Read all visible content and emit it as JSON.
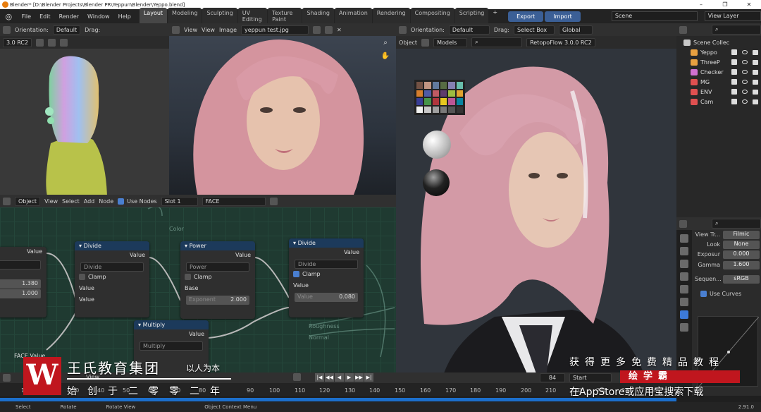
{
  "window": {
    "title": "Blender* [D:\\Blender Projects\\Blender PR\\Yeppun\\Blender\\Yeppo.blend]",
    "min": "–",
    "max": "❐",
    "close": "✕"
  },
  "menu": [
    "File",
    "Edit",
    "Render",
    "Window",
    "Help"
  ],
  "workspaces": [
    "Layout",
    "Modeling",
    "Sculpting",
    "UV Editing",
    "Texture Paint",
    "Shading",
    "Animation",
    "Rendering",
    "Compositing",
    "Scripting"
  ],
  "buttons": {
    "export": "Export",
    "import": "Import"
  },
  "scene": "Scene",
  "view_layer": "View Layer",
  "viewport1": {
    "orientation_label": "Orientation:",
    "orientation": "Default",
    "drag_label": "Drag:",
    "engine": "3.0 RC2"
  },
  "image_editor": {
    "menu_view1": "View",
    "menu_view2": "View",
    "menu_image": "Image",
    "file": "yeppun test.jpg"
  },
  "viewport2": {
    "orientation_label": "Orientation:",
    "orientation": "Default",
    "drag_label": "Drag:",
    "drag": "Select Box",
    "global": "Global",
    "object": "Object",
    "models": "Models",
    "engine": "RetopoFlow 3.0.0 RC2"
  },
  "node_editor": {
    "mode": "Object",
    "view": "View",
    "select": "Select",
    "add": "Add",
    "node": "Node",
    "use_nodes": "Use Nodes",
    "slot": "Slot 1",
    "material": "FACE",
    "nodes": {
      "left": {
        "value": "Value",
        "v1": "1.380",
        "v2": "1.000"
      },
      "divide1": {
        "title": "Divide",
        "out": "Value",
        "op": "Divide",
        "clamp": "Clamp",
        "in1": "Value",
        "in2": "Value"
      },
      "power": {
        "title": "Power",
        "out": "Value",
        "op": "Power",
        "clamp": "Clamp",
        "base": "Base",
        "exp_label": "Exponent",
        "exp": "2.000"
      },
      "divide2": {
        "title": "Divide",
        "out": "Value",
        "op": "Divide",
        "clamp": "Clamp",
        "in1": "Value",
        "in2_label": "Value",
        "in2": "0.080"
      },
      "multiply": {
        "title": "Multiply",
        "out": "Value",
        "op": "Multiply"
      },
      "ghost": {
        "color": "Color",
        "roughness": "Roughness",
        "normal": "Normal",
        "face": "FACE Value"
      }
    }
  },
  "outliner": {
    "root": "Scene Collec",
    "items": [
      {
        "name": "Yeppo",
        "color": "#e8a040"
      },
      {
        "name": "ThreeP",
        "color": "#e8a040"
      },
      {
        "name": "Checker",
        "color": "#d070d0"
      },
      {
        "name": "MG",
        "color": "#e05050"
      },
      {
        "name": "ENV",
        "color": "#e05050"
      },
      {
        "name": "Cam",
        "color": "#e05050"
      }
    ]
  },
  "properties": {
    "view_transform_label": "View Tr...",
    "view_transform": "Filmic",
    "look_label": "Look",
    "look": "None",
    "exposure_label": "Exposur",
    "exposure": "0.000",
    "gamma_label": "Gamma",
    "gamma": "1.600",
    "sequencer_label": "Sequen...",
    "sequencer": "sRGB",
    "use_curves": "Use Curves"
  },
  "timeline": {
    "ticks": [
      "10",
      "20",
      "30",
      "40",
      "50",
      "60",
      "70",
      "80",
      "90",
      "100",
      "110",
      "120",
      "130",
      "140",
      "150",
      "160",
      "170",
      "180",
      "190",
      "200",
      "210",
      "220",
      "230",
      "240",
      "250"
    ],
    "frame": "84",
    "start": "Start",
    "view": "View"
  },
  "status": {
    "select": "Select",
    "rotate": "Rotate",
    "rotate_view": "Rotate View",
    "context": "Object Context Menu",
    "version": "2.91.0"
  },
  "watermark": {
    "logo": "W",
    "name": "王氏教育集团",
    "slogan": "以人为本",
    "since": "始创于二零零二年",
    "right1": "获得更多免费精品教程",
    "brand": "绘学霸",
    "right2": "在AppStore或应用宝搜索下载"
  }
}
